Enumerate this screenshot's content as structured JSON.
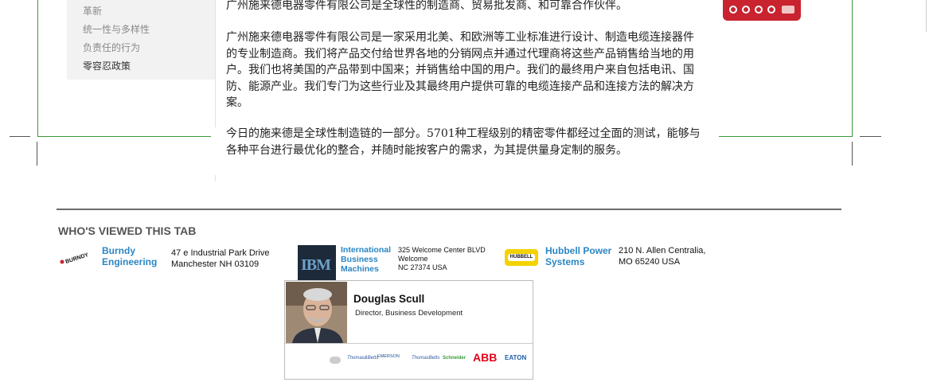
{
  "sidebar": {
    "items": [
      {
        "label": "革新",
        "active": false
      },
      {
        "label": "统一性与多样性",
        "active": false
      },
      {
        "label": "负责任的行为",
        "active": false
      },
      {
        "label": "零容忍政策",
        "active": true
      }
    ]
  },
  "main": {
    "paragraphs": [
      "广州施来德电器零件有限公司是全球性的制造商、贸易批发商、和可靠合作伙伴。",
      "广州施来德电器零件有限公司是一家采用北美、和欧洲等工业标准进行设计、制造电缆连接器件的专业制造商。我们将产品交付给世界各地的分销网点并通过代理商将这些产品销售给当地的用户。我们也将美国的产品带到中国来；并销售给中国的用户。我们的最终用户来自包括电讯、国防、能源产业。我们专门为这些行业及其最终用户提供可靠的电缆连接产品和连接方法的解决方案。",
      "今日的施来德是全球性制造链的一部分。5701种工程级别的精密零件都经过全面的测试，能够与各种平台进行最优化的整合，并随时能按客户的需求，为其提供量身定制的服务。"
    ]
  },
  "viewed": {
    "title": "WHO'S VIEWED THIS TAB",
    "companies": [
      {
        "logo": "BURNDY",
        "name_lines": [
          "Burndy",
          "Engineering"
        ],
        "address_lines": [
          "47 e Industrial Park Drive",
          "Manchester NH 03109"
        ]
      },
      {
        "logo": "IBM",
        "name_lines": [
          "International",
          "Business",
          "Machines"
        ],
        "address_lines": [
          "325 Welcome Center BLVD",
          "Welcome",
          "NC 27374 USA"
        ]
      },
      {
        "logo": "HUBBELL",
        "name_lines": [
          "Hubbell Power",
          "Systems"
        ],
        "address_lines": [
          "210 N. Allen Centralia,",
          "MO 65240 USA"
        ]
      }
    ]
  },
  "popup": {
    "name": "Douglas Scull",
    "title": "Director, Business Development",
    "logos": [
      "Thomas&Betts",
      "EMERSON",
      "ThomasBetts",
      "Schneider",
      "ABB",
      "EATON"
    ]
  },
  "colors": {
    "frame": "#3a9a3a",
    "link": "#2a86c4",
    "badge": "#c8232f",
    "abb": "#e2001a"
  }
}
